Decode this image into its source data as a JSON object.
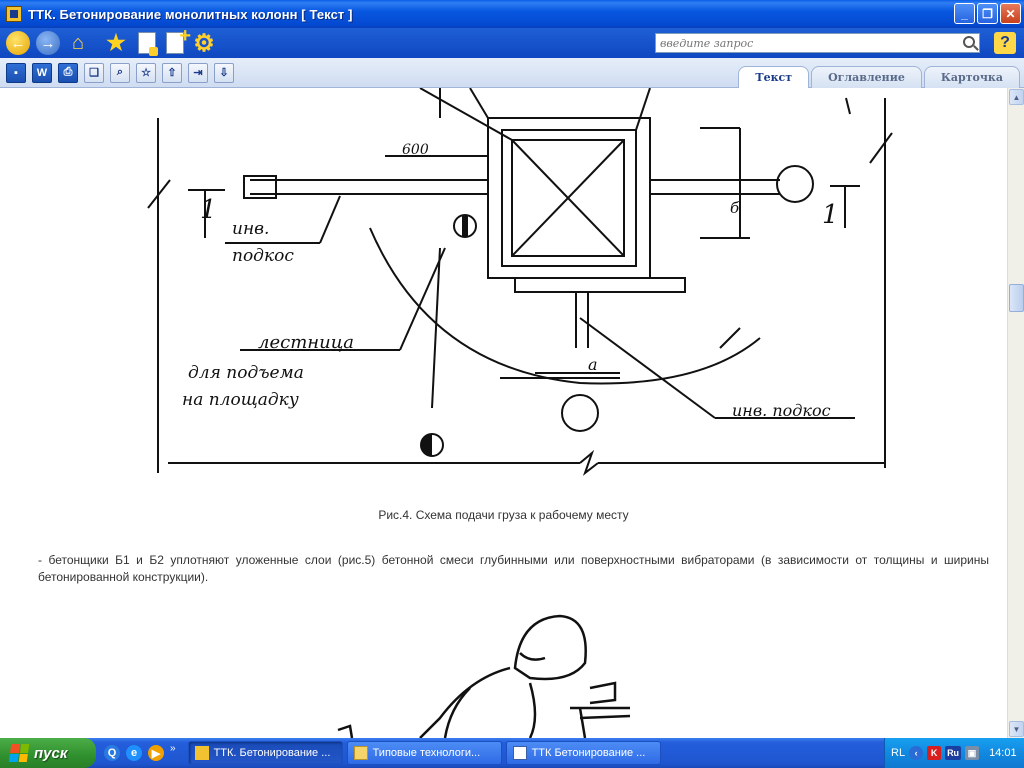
{
  "window": {
    "title": "ТТК. Бетонирование монолитных колонн [ Текст ]",
    "minimize": "_",
    "restore": "❐",
    "close": "✕"
  },
  "toolbar": {
    "search_placeholder": "введите запрос",
    "help": "?"
  },
  "tabs": [
    {
      "label": "Текст",
      "active": true
    },
    {
      "label": "Оглавление",
      "active": false
    },
    {
      "label": "Карточка",
      "active": false
    }
  ],
  "drawing": {
    "dim_600": "600",
    "label_1_left": "1",
    "label_1_right": "1",
    "inv": "инв.",
    "podkos": "подкос",
    "lestnica": "лестница",
    "dlya_podema": "для подъема",
    "na_ploshchadku": "на площадку",
    "dim_a": "a",
    "dim_b": "б",
    "inv_podkos": "инв. подкос"
  },
  "content": {
    "caption": "Рис.4. Схема подачи груза к рабочему месту",
    "paragraph": "- бетонщики Б1 и Б2 уплотняют уложенные слои (рис.5) бетонной смеси глубинными или поверхностными вибраторами (в зависимости от толщины и ширины бетонированной конструкции)."
  },
  "taskbar": {
    "start": "пуск",
    "tasks": [
      {
        "label": "ТТК. Бетонирование ...",
        "active": true
      },
      {
        "label": "Типовые технологи...",
        "active": false
      },
      {
        "label": "ТТК Бетонирование ...",
        "active": false
      }
    ],
    "lang": "RL",
    "ru": "Ru",
    "clock": "14:01"
  }
}
